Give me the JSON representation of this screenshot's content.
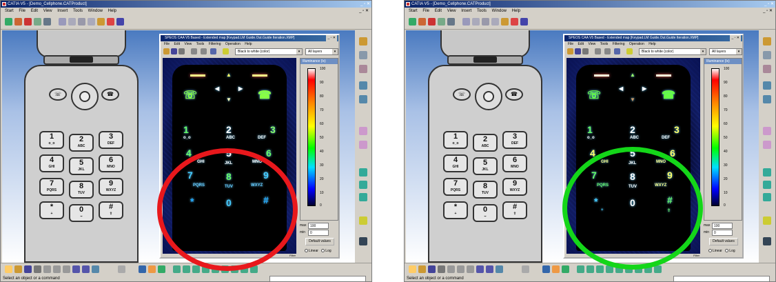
{
  "app": {
    "window_title": "CATIA V5 - [Demo_Cellphone.CATProduct]",
    "menu": [
      "Start",
      "File",
      "Edit",
      "View",
      "Insert",
      "Tools",
      "Window",
      "Help"
    ],
    "status_text": "Select an object or a command"
  },
  "speos": {
    "window_title": "SPEOS CAA V5 Based - Extended map [Keypad.LM Guide.Out.Guide Iteration.XMP]",
    "menu": [
      "File",
      "Edit",
      "View",
      "Tools",
      "Filtering",
      "Operation",
      "Help"
    ],
    "colormap_select": "Black to white (color)",
    "layers_select": "All layers",
    "legend_title": "Illuminance (lx)",
    "ticks": [
      "100",
      "90",
      "80",
      "70",
      "60",
      "50",
      "40",
      "30",
      "20",
      "10",
      "0"
    ],
    "max_label": "max",
    "min_label": "min",
    "max_value": "100",
    "min_value": "0",
    "default_button": "Default values",
    "linear_label": "Linear",
    "log_label": "Log",
    "filter_label": "Filter"
  },
  "phone": {
    "brand": "",
    "keys": [
      {
        "n": "1",
        "l": "o_o"
      },
      {
        "n": "2",
        "l": "ABC"
      },
      {
        "n": "3",
        "l": "DEF"
      },
      {
        "n": "4",
        "l": "GHI"
      },
      {
        "n": "5",
        "l": "JKL"
      },
      {
        "n": "6",
        "l": "MNO"
      },
      {
        "n": "7",
        "l": "PQRS"
      },
      {
        "n": "8",
        "l": "TUV"
      },
      {
        "n": "9",
        "l": "WXYZ"
      },
      {
        "n": "*",
        "l": "+"
      },
      {
        "n": "0",
        "l": "⌣"
      },
      {
        "n": "#",
        "l": "⇧"
      }
    ]
  },
  "annotations": {
    "left_circle_color": "#e8181c",
    "right_circle_color": "#14d619"
  }
}
